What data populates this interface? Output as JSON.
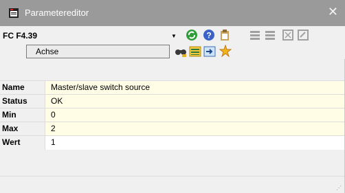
{
  "window": {
    "title": "Parametereditor",
    "icons": {
      "app": "editor-app-icon",
      "close": "close-icon"
    }
  },
  "toolbar": {
    "parameter_value": "FC F4.39",
    "search_value": "Achse",
    "icons": [
      "refresh-icon",
      "help-icon",
      "clipboard-icon",
      "insert-row-icon",
      "delete-row-icon",
      "export-icon",
      "edit-icon",
      "find-icon",
      "list-view-icon",
      "move-icon",
      "star-icon"
    ]
  },
  "grid": {
    "rows": [
      {
        "label": "Name",
        "value": "Master/slave switch source"
      },
      {
        "label": "Status",
        "value": "OK"
      },
      {
        "label": "Min",
        "value": "0"
      },
      {
        "label": "Max",
        "value": "2"
      },
      {
        "label": "Wert",
        "value": "1"
      }
    ]
  },
  "colors": {
    "titlebar": "#9a9a9a",
    "row_background": "#fffde6",
    "window_background": "#f0f0f0"
  }
}
